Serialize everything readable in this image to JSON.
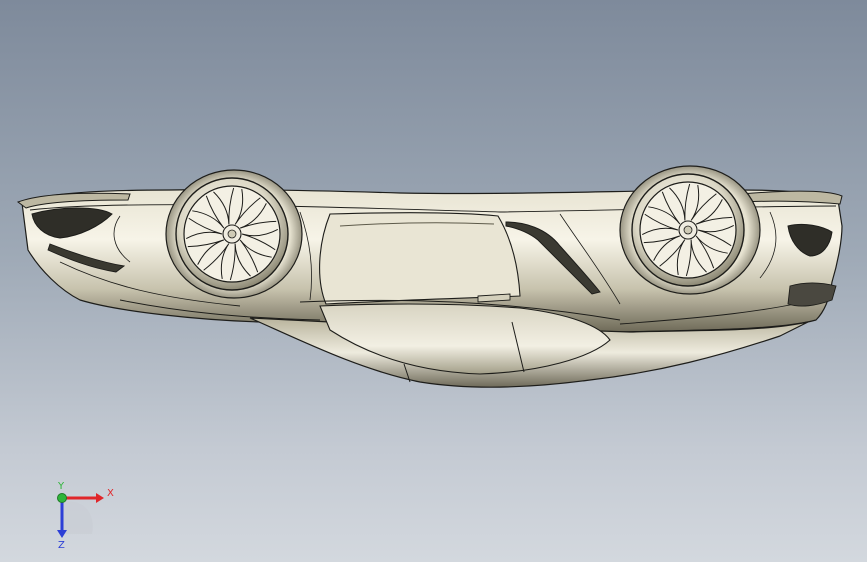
{
  "viewport": {
    "model_name": "",
    "view_orientation": "bottom",
    "display_style": "shaded-with-edges"
  },
  "triad": {
    "x_label": "X",
    "y_label": "Y",
    "z_label": "Z",
    "colors": {
      "x": "#e0262a",
      "y": "#2fb53a",
      "z": "#2c3fd6"
    }
  },
  "colors": {
    "background_top": "#7e8a9b",
    "background_bottom": "#d3d8de",
    "body_light": "#f4f1e4",
    "body_mid": "#cfcbb6",
    "body_dark": "#5a5748",
    "edge": "#1d1d1a"
  }
}
